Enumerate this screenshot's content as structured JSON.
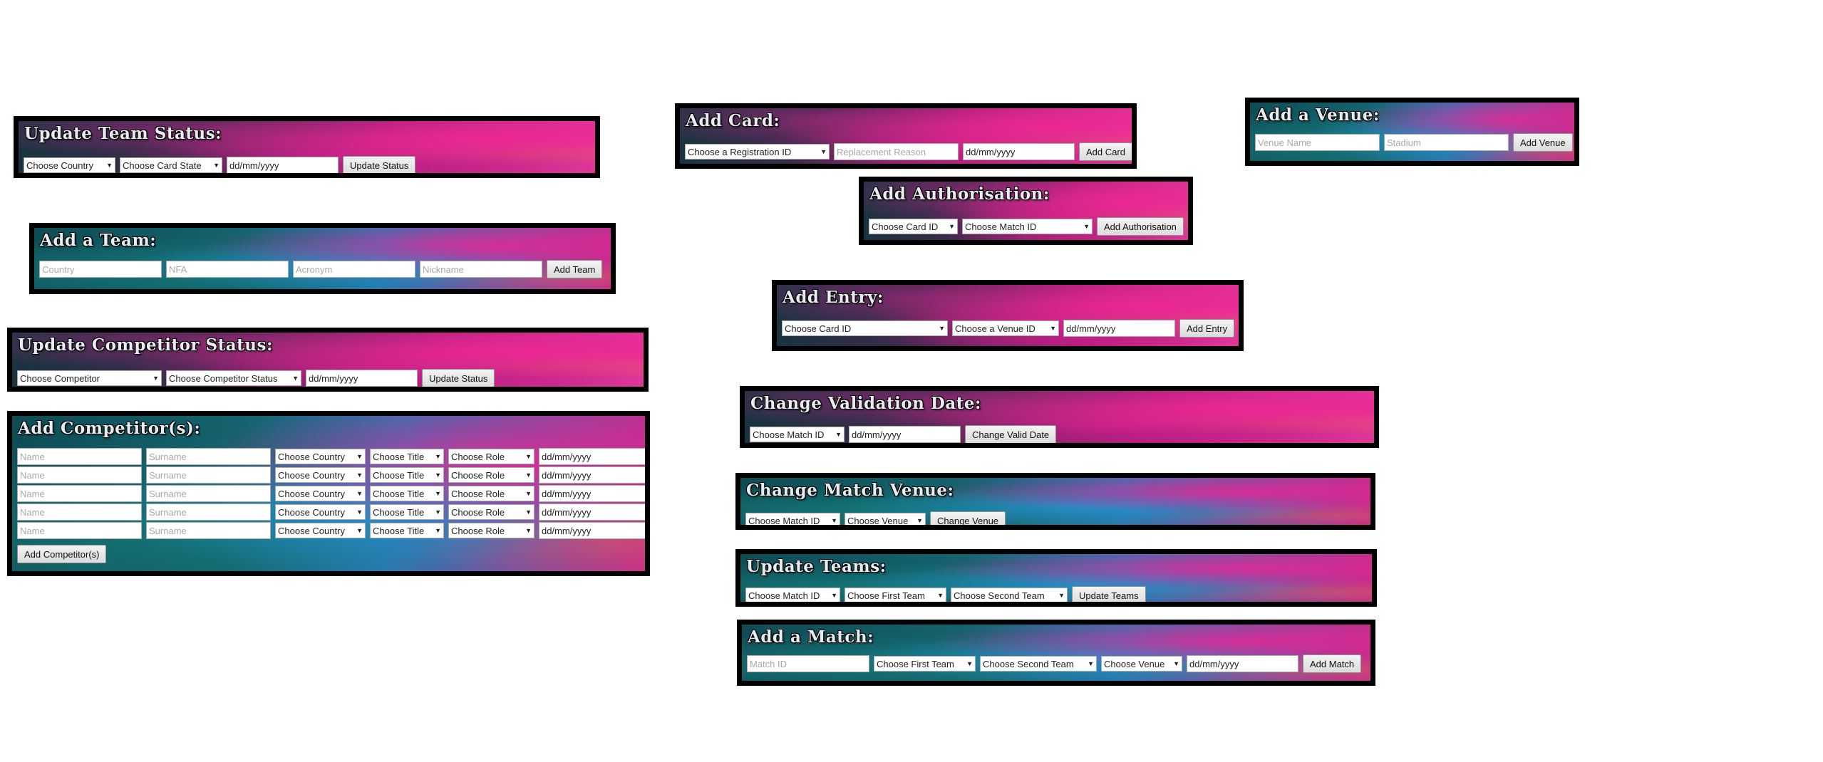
{
  "update_team_status": {
    "title": "Update Team Status:",
    "country_select": "Choose Country",
    "card_state_select": "Choose Card State",
    "date_placeholder": "dd/mm/yyyy",
    "button": "Update Status"
  },
  "add_team": {
    "title": "Add a Team:",
    "country_placeholder": "Country",
    "nfa_placeholder": "NFA",
    "acronym_placeholder": "Acronym",
    "nickname_placeholder": "Nickname",
    "button": "Add Team"
  },
  "update_competitor_status": {
    "title": "Update Competitor Status:",
    "competitor_select": "Choose Competitor",
    "status_select": "Choose Competitor Status",
    "date_placeholder": "dd/mm/yyyy",
    "button": "Update Status"
  },
  "add_competitors": {
    "title": "Add Competitor(s):",
    "name_placeholder": "Name",
    "surname_placeholder": "Surname",
    "country_select": "Choose Country",
    "title_select": "Choose Title",
    "role_select": "Choose Role",
    "date_placeholder": "dd/mm/yyyy",
    "button": "Add Competitor(s)"
  },
  "add_card": {
    "title": "Add Card:",
    "registration_select": "Choose a Registration ID",
    "reason_placeholder": "Replacement Reason",
    "date_placeholder": "dd/mm/yyyy",
    "button": "Add Card"
  },
  "add_authorisation": {
    "title": "Add Authorisation:",
    "card_select": "Choose Card ID",
    "match_select": "Choose Match ID",
    "button": "Add Authorisation"
  },
  "add_entry": {
    "title": "Add Entry:",
    "card_select": "Choose Card ID",
    "venue_select": "Choose a Venue ID",
    "date_placeholder": "dd/mm/yyyy",
    "button": "Add Entry"
  },
  "change_validation_date": {
    "title": "Change Validation Date:",
    "match_select": "Choose Match ID",
    "date_placeholder": "dd/mm/yyyy",
    "button": "Change Valid Date"
  },
  "change_match_venue": {
    "title": "Change Match Venue:",
    "match_select": "Choose Match ID",
    "venue_select": "Choose Venue",
    "button": "Change Venue"
  },
  "update_teams": {
    "title": "Update Teams:",
    "match_select": "Choose Match ID",
    "first_team_select": "Choose First Team",
    "second_team_select": "Choose Second Team",
    "button": "Update Teams"
  },
  "add_match": {
    "title": "Add a Match:",
    "match_id_placeholder": "Match ID",
    "first_team_select": "Choose First Team",
    "second_team_select": "Choose Second Team",
    "venue_select": "Choose Venue",
    "date_placeholder": "dd/mm/yyyy",
    "button": "Add Match"
  },
  "add_venue": {
    "title": "Add a Venue:",
    "venue_name_placeholder": "Venue Name",
    "stadium_placeholder": "Stadium",
    "button": "Add Venue"
  }
}
